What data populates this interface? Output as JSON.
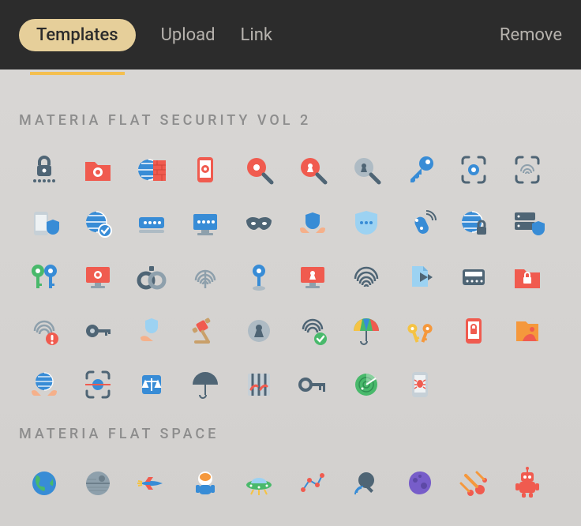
{
  "nav": {
    "templates": "Templates",
    "upload": "Upload",
    "link": "Link",
    "remove": "Remove"
  },
  "sections": {
    "security": {
      "title": "MATERIA FLAT SECURITY VOL 2"
    },
    "space": {
      "title": "MATERIA FLAT SPACE"
    }
  },
  "icons": {
    "security": [
      "padlock-password-icon",
      "eye-folder-icon",
      "firewall-globe-icon",
      "privacy-phone-icon",
      "search-eye-icon",
      "keyhole-search-icon",
      "keyhole-zoom-icon",
      "key-icon",
      "biometric-scan-icon",
      "fingerprint-scan-icon",
      "phone-shield-icon",
      "secure-globe-check-icon",
      "password-field-icon",
      "password-display-icon",
      "anonymous-mask-icon",
      "shield-hands-icon",
      "shield-password-icon",
      "key-fob-icon",
      "globe-lock-icon",
      "server-shield-icon",
      "two-keys-icon",
      "eye-monitor-icon",
      "handcuffs-icon",
      "fingerprint-icon",
      "pin-location-icon",
      "keyhole-display-icon",
      "fingerprint-large-icon",
      "document-share-icon",
      "pin-keypad-icon",
      "lock-folder-icon",
      "fingerprint-alert-icon",
      "key-small-icon",
      "hand-shield-icon",
      "gavel-icon",
      "keyhole-icon",
      "fingerprint-verified-icon",
      "umbrella-color-icon",
      "two-keys-gold-icon",
      "phone-lock-icon",
      "theft-folder-icon",
      "globe-hands-icon",
      "barcode-scan-icon",
      "law-scales-icon",
      "umbrella-solid-icon",
      "jail-bars-icon",
      "old-key-icon",
      "radar-icon",
      "phone-bug-icon"
    ],
    "space": [
      "earth-icon",
      "death-star-icon",
      "spaceship-icon",
      "astronaut-icon",
      "ufo-icon",
      "constellation-icon",
      "satellite-icon",
      "asteroid-icon",
      "meteor-shower-icon",
      "robot-icon"
    ]
  },
  "colors": {
    "red": "#f05b4f",
    "blue": "#388cd6",
    "slate": "#4f6575",
    "green": "#49b96b",
    "yellow": "#f5c344",
    "orange": "#f5983c"
  }
}
